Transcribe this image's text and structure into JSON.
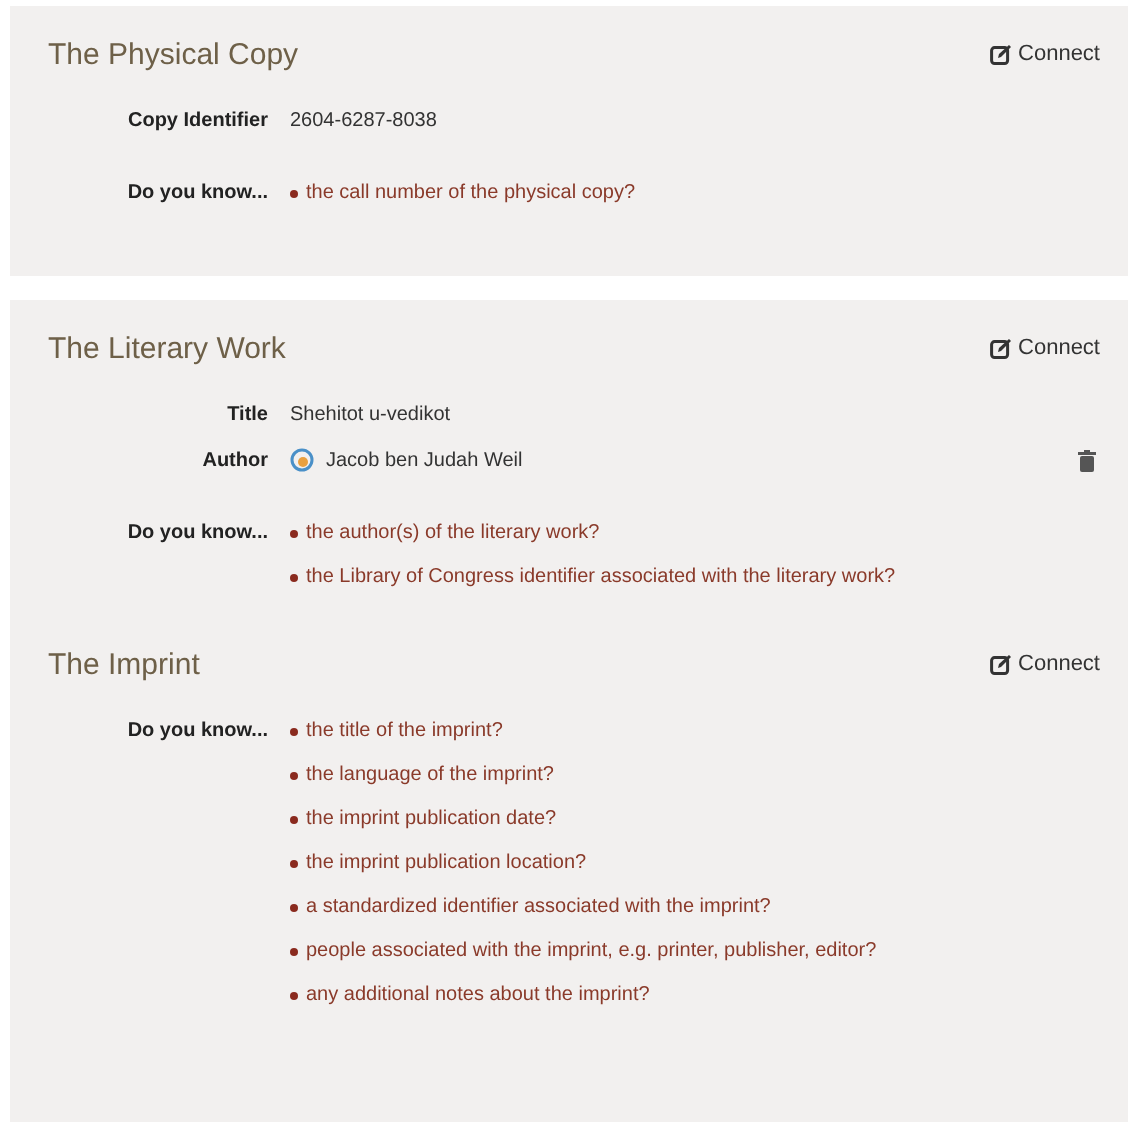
{
  "panels": [
    {
      "sections": [
        {
          "title": "The Physical Copy",
          "connect": "Connect",
          "fields": [
            {
              "kind": "text",
              "label": "Copy Identifier",
              "value": "2604-6287-8038",
              "deletable": false
            }
          ],
          "prompt_label": "Do you know...",
          "prompts": [
            "the call number of the physical copy?"
          ]
        }
      ]
    },
    {
      "sections": [
        {
          "title": "The Literary Work",
          "connect": "Connect",
          "fields": [
            {
              "kind": "text",
              "label": "Title",
              "value": "Shehitot u-vedikot",
              "deletable": false
            },
            {
              "kind": "person",
              "label": "Author",
              "value": "Jacob ben Judah Weil",
              "deletable": true
            }
          ],
          "prompt_label": "Do you know...",
          "prompts": [
            "the author(s) of the literary work?",
            "the Library of Congress identifier associated with the literary work?"
          ]
        },
        {
          "title": "The Imprint",
          "connect": "Connect",
          "prompt_label": "Do you know...",
          "prompts": [
            "the title of the imprint?",
            "the language of the imprint?",
            "the imprint publication date?",
            "the imprint publication location?",
            "a standardized identifier associated with the imprint?",
            "people associated with the imprint, e.g. printer, publisher, editor?",
            "any additional notes about the imprint?"
          ]
        }
      ]
    }
  ]
}
